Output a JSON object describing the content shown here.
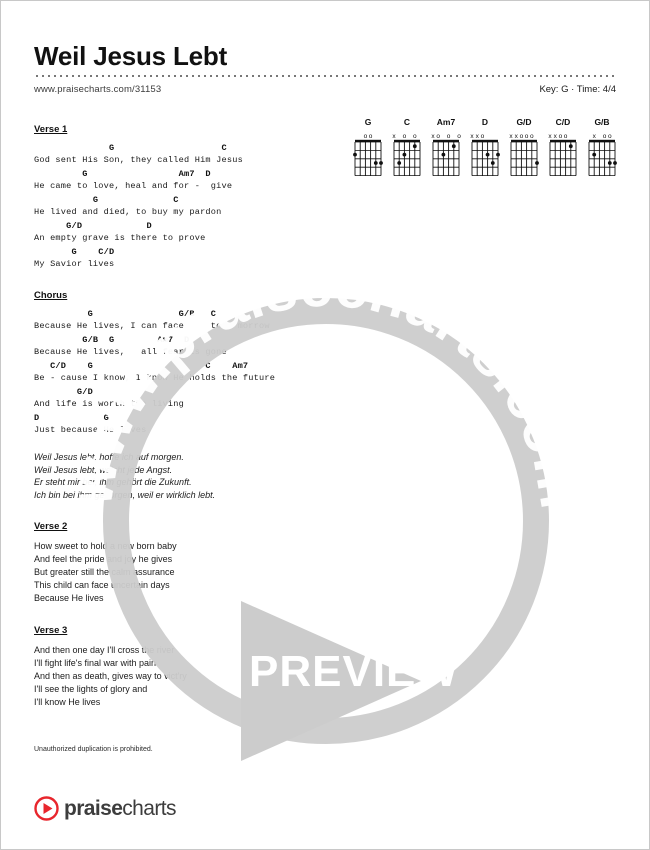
{
  "header": {
    "title": "Weil Jesus Lebt",
    "url": "www.praisecharts.com/31153",
    "key_time": "Key: G · Time: 4/4"
  },
  "chords": [
    {
      "name": "G",
      "markers": [
        "",
        "",
        "o",
        "o",
        "",
        ""
      ],
      "dots": [
        [
          6,
          2
        ],
        [
          2,
          3
        ],
        [
          1,
          3
        ]
      ]
    },
    {
      "name": "C",
      "markers": [
        "x",
        "",
        "o",
        "",
        "o",
        ""
      ],
      "dots": [
        [
          5,
          3
        ],
        [
          4,
          2
        ],
        [
          2,
          1
        ]
      ]
    },
    {
      "name": "Am7",
      "markers": [
        "x",
        "o",
        "",
        "o",
        "",
        "o"
      ],
      "dots": [
        [
          4,
          2
        ],
        [
          2,
          1
        ]
      ]
    },
    {
      "name": "D",
      "markers": [
        "x",
        "x",
        "o",
        "",
        "",
        ""
      ],
      "dots": [
        [
          3,
          2
        ],
        [
          1,
          2
        ],
        [
          2,
          3
        ]
      ]
    },
    {
      "name": "G/D",
      "markers": [
        "x",
        "x",
        "o",
        "o",
        "o",
        ""
      ],
      "dots": [
        [
          1,
          3
        ]
      ]
    },
    {
      "name": "C/D",
      "markers": [
        "x",
        "x",
        "o",
        "o",
        "",
        ""
      ],
      "dots": [
        [
          2,
          1
        ]
      ]
    },
    {
      "name": "G/B",
      "markers": [
        "",
        "x",
        "",
        "o",
        "o",
        ""
      ],
      "dots": [
        [
          5,
          2
        ],
        [
          2,
          3
        ],
        [
          1,
          3
        ]
      ]
    }
  ],
  "sections": [
    {
      "label": "Verse 1",
      "lines": [
        {
          "chords": "              G                    C",
          "lyric": "God sent His Son, they called Him Jesus"
        },
        {
          "chords": "         G                 Am7  D",
          "lyric": "He came to love, heal and for -  give"
        },
        {
          "chords": "           G              C",
          "lyric": "He lived and died, to buy my pardon"
        },
        {
          "chords": "      G/D            D",
          "lyric": "An empty grave is there to prove"
        },
        {
          "chords": "       G    C/D",
          "lyric": "My Savior lives"
        }
      ]
    },
    {
      "label": "Chorus",
      "lines": [
        {
          "chords": "          G                G/B   C",
          "lyric": "Because He lives, I can face     to - morrow"
        },
        {
          "chords": "         G/B  G        Am7  D",
          "lyric": "Because He lives,   all fear is gone"
        },
        {
          "chords": "   C/D    G                     C    Am7",
          "lyric": "Be - cause I know, I know He holds the future"
        },
        {
          "chords": "        G/D",
          "lyric": "And life is worth the living"
        },
        {
          "chords": "D            G",
          "lyric": "Just because He lives"
        }
      ]
    }
  ],
  "german_lines": [
    "Weil Jesus lebt, hoffe ich auf morgen.",
    "Weil Jesus lebt, weicht jede Angst.",
    "Er steht mir bei, ihm gehört die Zukunft.",
    "Ich bin bei ihm geborgen, weil er wirklich lebt."
  ],
  "verse2": {
    "label": "Verse 2",
    "lines": [
      "How sweet to hold a new born baby",
      "And feel the pride and joy he gives",
      "But greater still the calm assurance",
      "This child can face uncertain days",
      "Because He lives"
    ]
  },
  "verse3": {
    "label": "Verse 3",
    "lines": [
      "And then one day I'll cross the river",
      "I'll fight life's final war with pain",
      "And then as death, gives way to vict'ry",
      "I'll see the lights of glory and",
      "I'll know He lives"
    ]
  },
  "footer": {
    "copyright": "Unauthorized duplication is prohibited.",
    "logo_bold": "praise",
    "logo_light": "charts"
  },
  "watermark": {
    "text": "www.praisecharts.com",
    "preview_label": "PREVIEW"
  },
  "colors": {
    "logo_red": "#e8262d",
    "watermark_gray": "#cccccc",
    "text": "#1b1b1b"
  }
}
